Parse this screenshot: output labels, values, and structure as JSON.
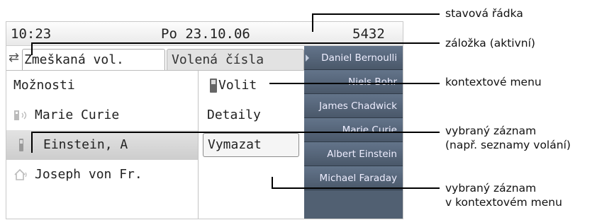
{
  "status_bar": {
    "time": "10:23",
    "date": "Po 23.10.06",
    "extension": "5432"
  },
  "tabs": {
    "active": "Zmeškaná vol.",
    "inactive": "Volená čísla"
  },
  "list": {
    "items": [
      {
        "label": "Možnosti",
        "icon": "none"
      },
      {
        "label": "Marie Curie",
        "icon": "phone-signal-icon"
      },
      {
        "label": "Einstein, A",
        "icon": "mobile-phone-icon",
        "selected": true
      },
      {
        "label": "Joseph von Fr.",
        "icon": "home-icon"
      }
    ]
  },
  "context_menu": {
    "items": [
      {
        "label": "Volit",
        "icon": "mobile-phone-icon"
      },
      {
        "label": "Detaily"
      },
      {
        "label": "Vymazat",
        "selected": true
      }
    ]
  },
  "phonebook": [
    "Daniel Bernoulli",
    "Niels Bohr",
    "James Chadwick",
    "Marie Curie",
    "Albert Einstein",
    "Michael Faraday"
  ],
  "annotations": {
    "status_line": "stavová řádka",
    "active_tab": "záložka (aktivní)",
    "context_menu": "kontextové menu",
    "selected_entry_1": "vybraný záznam",
    "selected_entry_2": "(např. seznamy volání)",
    "selected_ctx_1": "vybraný záznam",
    "selected_ctx_2": "v kontextovém menu"
  },
  "colors": {
    "phonebook_bg": "#516072",
    "selection": "#d6d6d6"
  }
}
